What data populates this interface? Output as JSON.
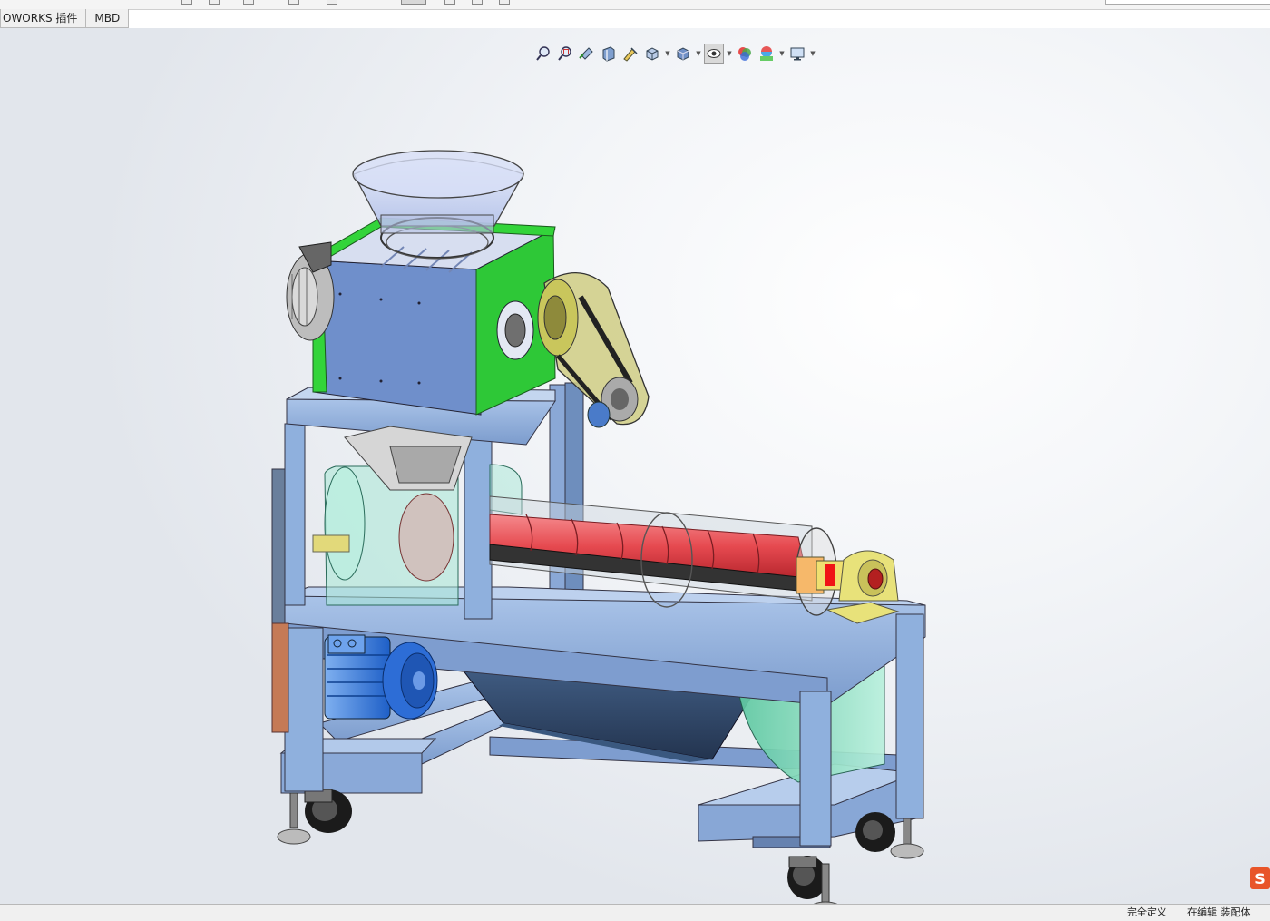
{
  "tabs": [
    {
      "label": "OWORKS 插件"
    },
    {
      "label": "MBD"
    }
  ],
  "view_toolbar": {
    "buttons": [
      {
        "icon": "zoom-to-fit-icon"
      },
      {
        "icon": "zoom-to-area-icon"
      },
      {
        "icon": "previous-view-icon"
      },
      {
        "icon": "section-view-icon"
      },
      {
        "icon": "dynamic-annotation-icon"
      },
      {
        "icon": "view-orientation-icon"
      },
      {
        "icon": "display-style-icon"
      },
      {
        "icon": "hide-show-items-icon"
      },
      {
        "icon": "edit-appearance-icon"
      },
      {
        "icon": "apply-scene-icon"
      },
      {
        "icon": "view-settings-icon"
      }
    ]
  },
  "status_bar": {
    "definition": "完全定义",
    "mode": "在编辑 装配体"
  },
  "colors": {
    "frame_blue": "#8fb0dd",
    "housing_green": "#33d43a",
    "screw_red": "#e8545a",
    "motor_blue": "#2e6fd8",
    "bearing_yellow": "#e8e27a",
    "belt_guard_olive": "#cfcc84",
    "hopper_violet": "#c9d4f2",
    "transparent_cyan": "#a7e8d6"
  }
}
